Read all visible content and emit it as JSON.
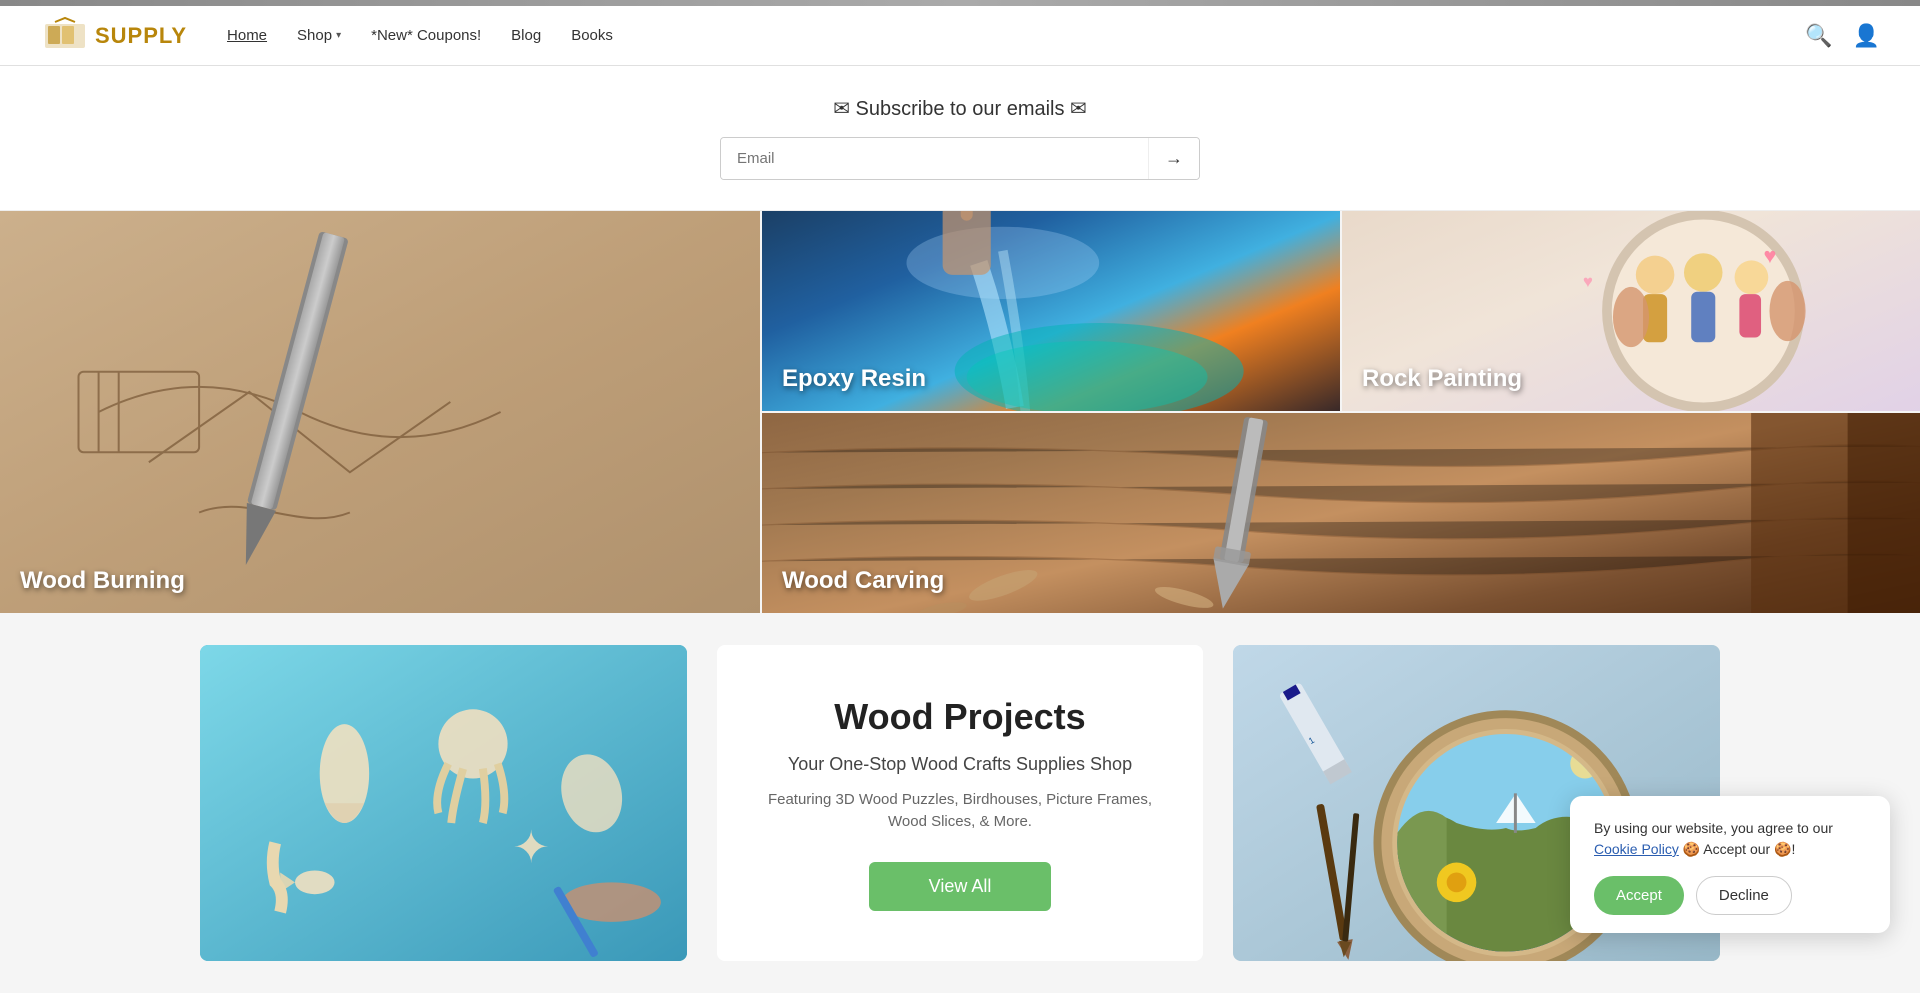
{
  "header": {
    "logo_text": "SUPPLY",
    "nav": {
      "home": "Home",
      "shop": "Shop",
      "coupons": "*New* Coupons!",
      "blog": "Blog",
      "books": "Books"
    },
    "active": "Home"
  },
  "subscribe": {
    "title": "✉ Subscribe to our emails ✉",
    "email_placeholder": "Email",
    "submit_arrow": "→"
  },
  "image_grid": {
    "wood_burning": "Wood Burning",
    "epoxy_resin": "Epoxy Resin",
    "rock_painting": "Rock Painting",
    "wood_carving": "Wood Carving"
  },
  "bottom": {
    "center_title": "Wood Projects",
    "center_subtitle": "Your One-Stop Wood Crafts Supplies Shop",
    "center_desc": "Featuring 3D Wood Puzzles, Birdhouses, Picture Frames, Wood Slices, & More.",
    "view_all_label": "View All"
  },
  "cookie": {
    "text": "By using our website, you agree to our ",
    "link_text": "Cookie Policy",
    "suffix": "🍪 Accept our 🍪!",
    "accept_label": "Accept",
    "decline_label": "Decline"
  }
}
